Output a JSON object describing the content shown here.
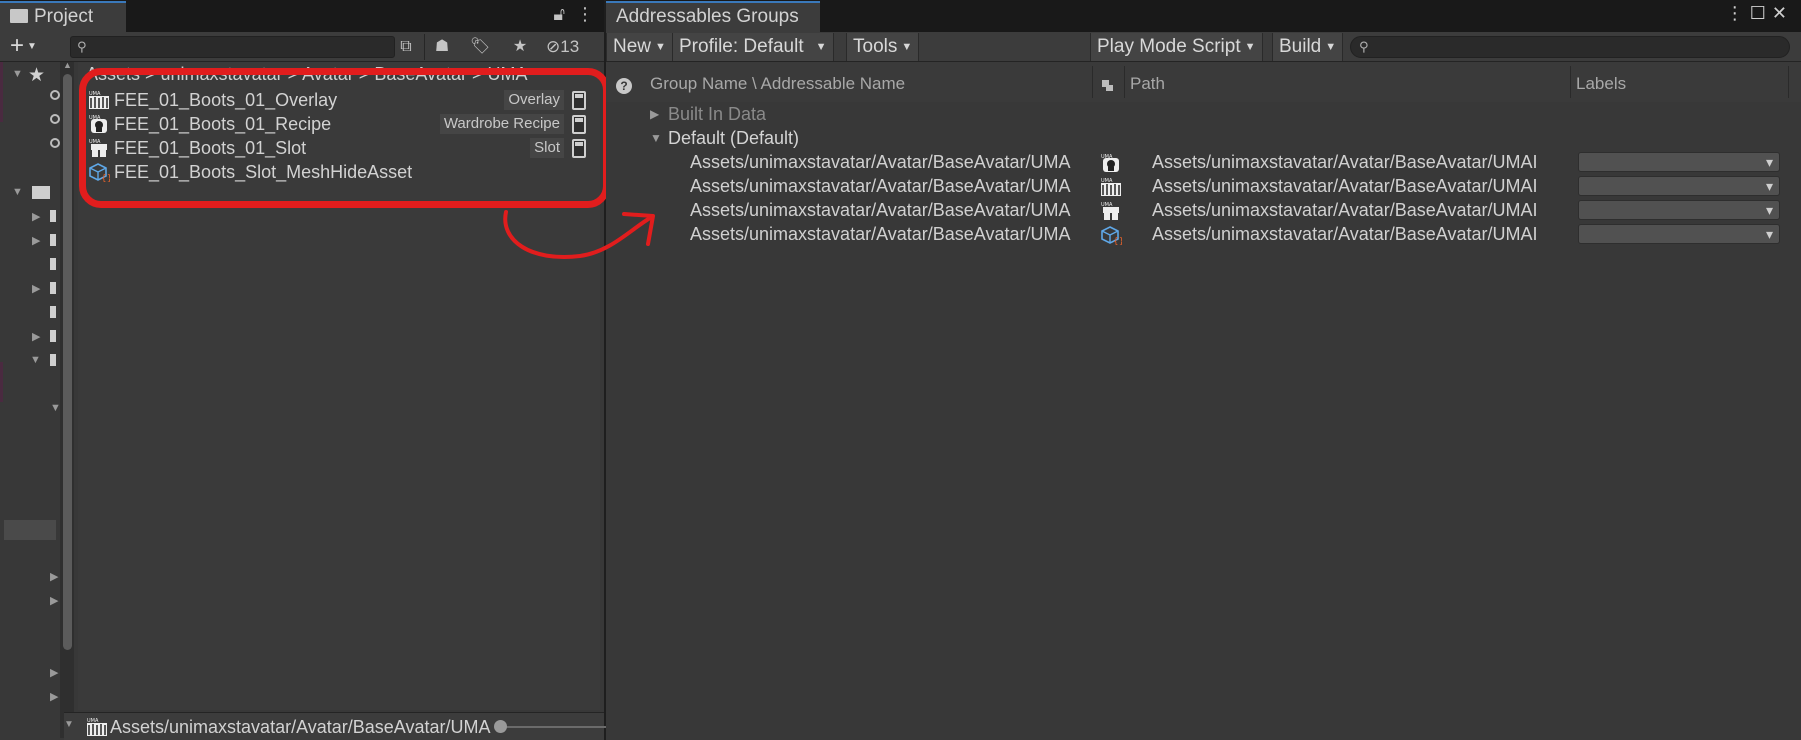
{
  "project": {
    "tab_title": "Project",
    "toolbar": {
      "search_placeholder": "",
      "hidden_count": "13"
    },
    "breadcrumb": "Assets > unimaxstavatar > Avatar > BaseAvatar > UMA",
    "assets": [
      {
        "name": "FEE_01_Boots_01_Overlay",
        "type": "Overlay",
        "icon": "uma-overlay-icon"
      },
      {
        "name": "FEE_01_Boots_01_Recipe",
        "type": "Wardrobe Recipe",
        "icon": "uma-recipe-icon"
      },
      {
        "name": "FEE_01_Boots_01_Slot",
        "type": "Slot",
        "icon": "uma-slot-icon"
      },
      {
        "name": "FEE_01_Boots_Slot_MeshHideAsset",
        "type": "",
        "icon": "meshhide-asset-icon"
      }
    ],
    "bottom_path": "Assets/unimaxstavatar/Avatar/BaseAvatar/UMA"
  },
  "groups": {
    "tab_title": "Addressables Groups",
    "toolbar": {
      "new_label": "New",
      "profile_label": "Profile: Default",
      "tools_label": "Tools",
      "play_mode_label": "Play Mode Script",
      "build_label": "Build",
      "search_placeholder": ""
    },
    "columns": {
      "name": "Group Name \\ Addressable Name",
      "path": "Path",
      "labels": "Labels"
    },
    "groups": [
      {
        "label": "Built In Data",
        "expanded": false
      },
      {
        "label": "Default (Default)",
        "expanded": true
      }
    ],
    "entries": [
      {
        "name": "Assets/unimaxstavatar/Avatar/BaseAvatar/UMA",
        "path": "Assets/unimaxstavatar/Avatar/BaseAvatar/UMAI",
        "icon": "uma-recipe-icon"
      },
      {
        "name": "Assets/unimaxstavatar/Avatar/BaseAvatar/UMA",
        "path": "Assets/unimaxstavatar/Avatar/BaseAvatar/UMAI",
        "icon": "uma-overlay-icon"
      },
      {
        "name": "Assets/unimaxstavatar/Avatar/BaseAvatar/UMA",
        "path": "Assets/unimaxstavatar/Avatar/BaseAvatar/UMAI",
        "icon": "uma-slot-icon"
      },
      {
        "name": "Assets/unimaxstavatar/Avatar/BaseAvatar/UMA",
        "path": "Assets/unimaxstavatar/Avatar/BaseAvatar/UMAI",
        "icon": "meshhide-asset-icon"
      }
    ]
  },
  "colors": {
    "annotation_red": "#e11d1d",
    "tab_accent": "#3a79bb",
    "panel_bg": "#383838"
  }
}
